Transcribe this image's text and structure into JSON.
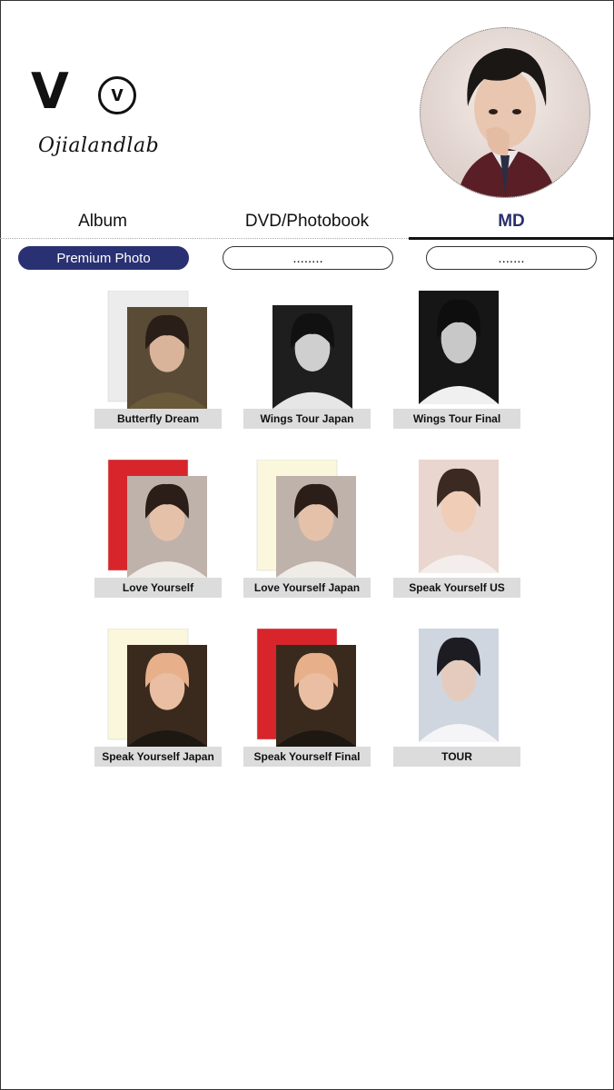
{
  "header": {
    "title": "V",
    "logo_letter": "v",
    "brand": "Ojialandlab"
  },
  "tabs": [
    {
      "label": "Album",
      "active": false
    },
    {
      "label": "DVD/Photobook",
      "active": false
    },
    {
      "label": "MD",
      "active": true
    }
  ],
  "filters": [
    {
      "label": "Premium Photo",
      "active": true
    },
    {
      "label": "........",
      "active": false
    },
    {
      "label": ".......",
      "active": false
    }
  ],
  "items": [
    {
      "label": "Butterfly Dream",
      "back_color": "#ececec",
      "photo": "camo"
    },
    {
      "label": "Wings Tour Japan",
      "back_color": null,
      "photo": "bw"
    },
    {
      "label": "Wings Tour Final",
      "back_color": null,
      "photo": "bw-dark"
    },
    {
      "label": "Love Yourself",
      "back_color": "#d8252b",
      "photo": "portrait"
    },
    {
      "label": "Love Yourself Japan",
      "back_color": "#fbf7dc",
      "photo": "portrait"
    },
    {
      "label": "Speak Yourself US",
      "back_color": null,
      "photo": "soft"
    },
    {
      "label": "Speak Yourself Japan",
      "back_color": "#fbf7dc",
      "photo": "blonde"
    },
    {
      "label": "Speak Yourself Final",
      "back_color": "#d8252b",
      "photo": "blonde"
    },
    {
      "label": "TOUR",
      "back_color": null,
      "photo": "white-suit"
    }
  ],
  "colors": {
    "accent": "#2a3172",
    "label_bg": "#dcdcdc",
    "red_card": "#d8252b",
    "cream_card": "#fbf7dc"
  }
}
